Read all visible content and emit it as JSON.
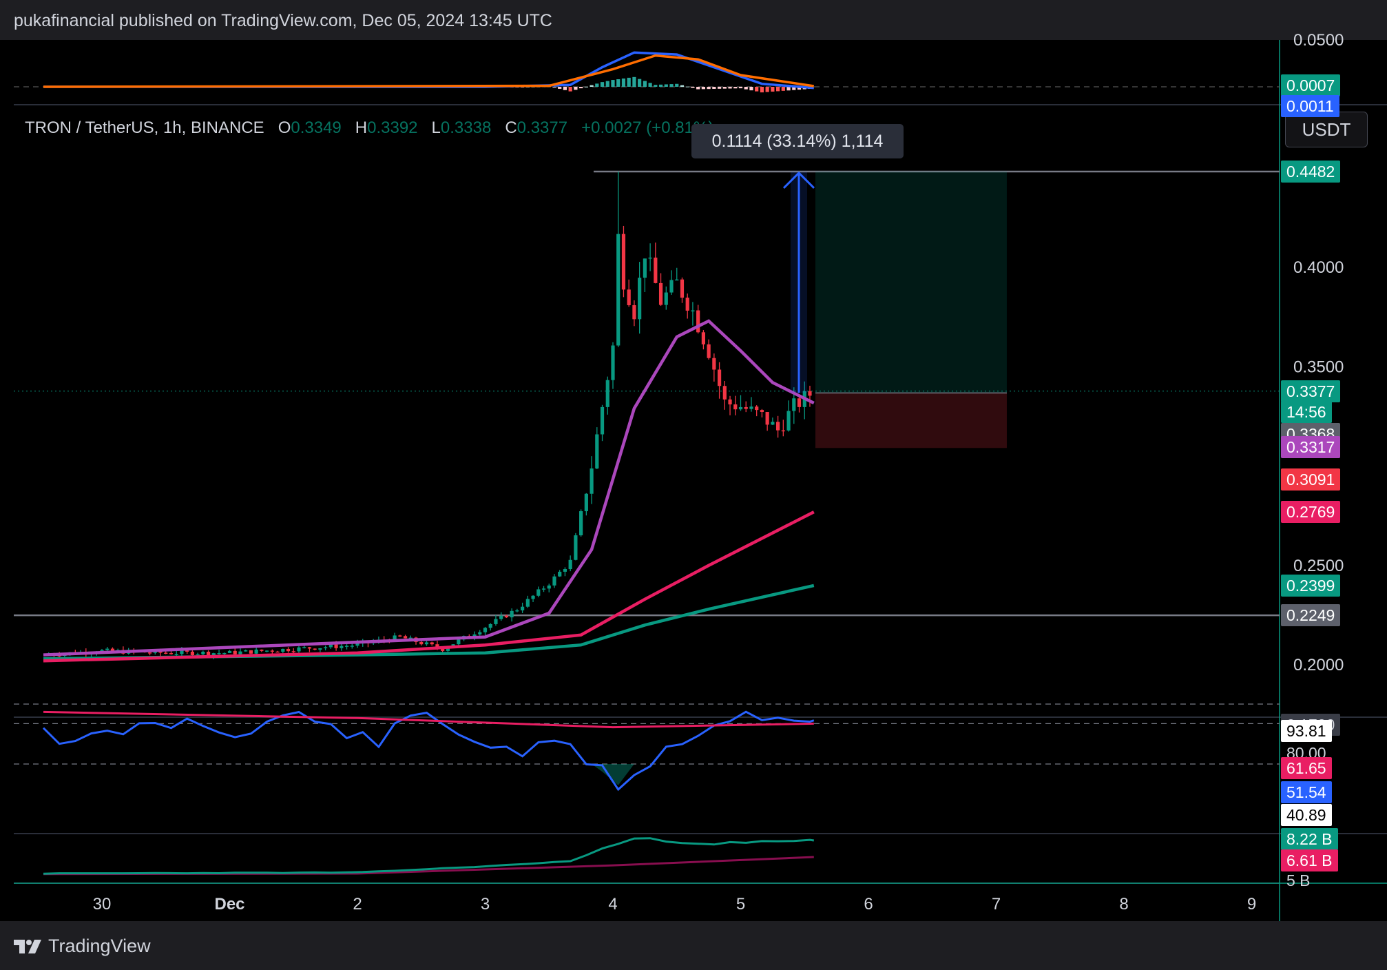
{
  "header": {
    "attribution": "pukafinancial published on TradingView.com, Dec 05, 2024 13:45 UTC"
  },
  "footer": {
    "brand": "TradingView"
  },
  "symbol": {
    "name": "TRON / TetherUS, 1h, BINANCE",
    "o_label": "O",
    "o": "0.3349",
    "h_label": "H",
    "h": "0.3392",
    "l_label": "L",
    "l": "0.3338",
    "c_label": "C",
    "c": "0.3377",
    "change": "+0.0027 (+0.81%)"
  },
  "currency_button": "USDT",
  "measure_label": "0.1114 (33.14%) 1,114",
  "colors": {
    "up": "#089981",
    "down": "#f23645",
    "ema_fast": "#ab47bc",
    "ema_mid": "#e91e63",
    "ema_slow": "#089981",
    "macd": "#2962ff",
    "signal": "#ff6d00",
    "rsi": "#2962ff",
    "rsi_ma": "#e91e63",
    "obv": "#089981",
    "obv_ma": "#880e4f",
    "grid_line": "#787b86"
  },
  "price_axis": {
    "ticks": [
      "0.4000",
      "0.3500",
      "0.2500",
      "0.2000"
    ],
    "labels": [
      {
        "text": "0.4482",
        "bg": "#089981",
        "fg": "#ffffff"
      },
      {
        "text": "0.3377",
        "bg": "#089981",
        "fg": "#ffffff"
      },
      {
        "text": "14:56",
        "bg": "#089981",
        "fg": "#ffffff"
      },
      {
        "text": "0.3368",
        "bg": "#5d606b",
        "fg": "#ffffff"
      },
      {
        "text": "0.3317",
        "bg": "#ab47bc",
        "fg": "#ffffff"
      },
      {
        "text": "0.3091",
        "bg": "#f23645",
        "fg": "#ffffff"
      },
      {
        "text": "0.2769",
        "bg": "#e91e63",
        "fg": "#ffffff"
      },
      {
        "text": "0.2399",
        "bg": "#089981",
        "fg": "#ffffff"
      },
      {
        "text": "0.2249",
        "bg": "#5d606b",
        "fg": "#ffffff"
      },
      {
        "text": "0.1700",
        "bg": "#3a3d47",
        "fg": "#d1d4dc"
      }
    ]
  },
  "macd_axis": {
    "top": "0.0500",
    "labels": [
      {
        "text": "0.0007",
        "bg": "#089981",
        "fg": "#ffffff"
      },
      {
        "text": "0.0011",
        "bg": "#2962ff",
        "fg": "#ffffff"
      }
    ]
  },
  "rsi_axis": {
    "labels": [
      {
        "text": "93.81",
        "bg": "#ffffff",
        "fg": "#000000"
      },
      {
        "text": "80.00",
        "bg": "",
        "fg": "#d1d4dc"
      },
      {
        "text": "61.65",
        "bg": "#e91e63",
        "fg": "#ffffff"
      },
      {
        "text": "51.54",
        "bg": "#2962ff",
        "fg": "#ffffff"
      },
      {
        "text": "40.89",
        "bg": "#ffffff",
        "fg": "#000000"
      }
    ]
  },
  "obv_axis": {
    "labels": [
      {
        "text": "8.22 B",
        "bg": "#089981",
        "fg": "#ffffff"
      },
      {
        "text": "6.61 B",
        "bg": "#e91e63",
        "fg": "#ffffff"
      },
      {
        "text": "5 B",
        "bg": "",
        "fg": "#d1d4dc"
      }
    ]
  },
  "time_axis": [
    "30",
    "Dec",
    "2",
    "3",
    "4",
    "5",
    "6",
    "7",
    "8",
    "9"
  ],
  "chart_data": {
    "type": "candlestick",
    "title": "TRON / TetherUS, 1h, BINANCE",
    "ylim": [
      0.17,
      0.47
    ],
    "x_range_days": [
      "2024-11-29T14:00",
      "2024-12-09T22:00"
    ],
    "ohlc_last": {
      "open": 0.3349,
      "high": 0.3392,
      "low": 0.3338,
      "close": 0.3377
    },
    "close_path": [
      [
        "2024-11-29T13:00",
        0.205
      ],
      [
        "2024-11-30T00:00",
        0.207
      ],
      [
        "2024-11-30T12:00",
        0.206
      ],
      [
        "2024-12-01T00:00",
        0.206
      ],
      [
        "2024-12-01T12:00",
        0.208
      ],
      [
        "2024-12-02T00:00",
        0.21
      ],
      [
        "2024-12-02T08:00",
        0.214
      ],
      [
        "2024-12-02T16:00",
        0.208
      ],
      [
        "2024-12-03T00:00",
        0.219
      ],
      [
        "2024-12-03T06:00",
        0.228
      ],
      [
        "2024-12-03T12:00",
        0.241
      ],
      [
        "2024-12-03T16:00",
        0.252
      ],
      [
        "2024-12-03T20:00",
        0.3
      ],
      [
        "2024-12-03T22:00",
        0.33
      ],
      [
        "2024-12-04T00:00",
        0.36
      ],
      [
        "2024-12-04T01:00",
        0.415
      ],
      [
        "2024-12-04T02:00",
        0.394
      ],
      [
        "2024-12-04T04:00",
        0.378
      ],
      [
        "2024-12-04T06:00",
        0.408
      ],
      [
        "2024-12-04T09:00",
        0.383
      ],
      [
        "2024-12-04T12:00",
        0.392
      ],
      [
        "2024-12-04T15:00",
        0.378
      ],
      [
        "2024-12-04T18:00",
        0.358
      ],
      [
        "2024-12-04T21:00",
        0.332
      ],
      [
        "2024-12-05T00:00",
        0.33
      ],
      [
        "2024-12-05T04:00",
        0.325
      ],
      [
        "2024-12-05T07:00",
        0.318
      ],
      [
        "2024-12-05T10:00",
        0.33
      ],
      [
        "2024-12-05T13:45",
        0.3377
      ]
    ],
    "high_max": 0.4482,
    "ema_fast": [
      [
        "2024-11-29T13:00",
        0.205
      ],
      [
        "2024-12-03T00:00",
        0.214
      ],
      [
        "2024-12-03T12:00",
        0.226
      ],
      [
        "2024-12-03T20:00",
        0.258
      ],
      [
        "2024-12-04T04:00",
        0.329
      ],
      [
        "2024-12-04T12:00",
        0.365
      ],
      [
        "2024-12-04T18:00",
        0.373
      ],
      [
        "2024-12-05T00:00",
        0.358
      ],
      [
        "2024-12-05T06:00",
        0.342
      ],
      [
        "2024-12-05T13:45",
        0.3317
      ]
    ],
    "ema_mid": [
      [
        "2024-11-29T13:00",
        0.202
      ],
      [
        "2024-12-02T00:00",
        0.206
      ],
      [
        "2024-12-03T00:00",
        0.21
      ],
      [
        "2024-12-03T18:00",
        0.215
      ],
      [
        "2024-12-04T06:00",
        0.233
      ],
      [
        "2024-12-04T18:00",
        0.25
      ],
      [
        "2024-12-05T13:45",
        0.2769
      ]
    ],
    "ema_slow": [
      [
        "2024-11-29T13:00",
        0.203
      ],
      [
        "2024-12-02T00:00",
        0.205
      ],
      [
        "2024-12-03T00:00",
        0.206
      ],
      [
        "2024-12-03T18:00",
        0.21
      ],
      [
        "2024-12-04T06:00",
        0.22
      ],
      [
        "2024-12-04T18:00",
        0.228
      ],
      [
        "2024-12-05T13:45",
        0.2399
      ]
    ],
    "horizontal_levels": [
      0.4482,
      0.2249
    ],
    "last_price": 0.3377,
    "position": {
      "entry": 0.3368,
      "target": 0.4482,
      "stop": 0.3091,
      "end": "2024-12-07T02:00"
    },
    "measure": {
      "from": 0.3368,
      "to": 0.4482,
      "change": 0.1114,
      "percent": 33.14,
      "ticks": 1114
    },
    "macd": {
      "macd_line": [
        [
          "2024-11-29T13:00",
          0.0
        ],
        [
          "2024-12-03T00:00",
          0.0
        ],
        [
          "2024-12-03T16:00",
          0.002
        ],
        [
          "2024-12-03T22:00",
          0.02
        ],
        [
          "2024-12-04T04:00",
          0.035
        ],
        [
          "2024-12-04T12:00",
          0.033
        ],
        [
          "2024-12-04T20:00",
          0.018
        ],
        [
          "2024-12-05T04:00",
          0.003
        ],
        [
          "2024-12-05T13:45",
          -0.0011
        ]
      ],
      "signal_line": [
        [
          "2024-11-29T13:00",
          0.0
        ],
        [
          "2024-12-03T12:00",
          0.001
        ],
        [
          "2024-12-04T00:00",
          0.018
        ],
        [
          "2024-12-04T08:00",
          0.032
        ],
        [
          "2024-12-04T16:00",
          0.028
        ],
        [
          "2024-12-05T00:00",
          0.012
        ],
        [
          "2024-12-05T13:45",
          0.0007
        ]
      ],
      "last_macd": -0.0011,
      "last_signal": 0.0007
    },
    "rsi": {
      "upper": 80,
      "lower": 40.89,
      "mid_band": 61.65,
      "last": 51.54,
      "max": 93.81,
      "values": [
        [
          "2024-11-29T13:00",
          55
        ],
        [
          "2024-11-29T18:00",
          68
        ],
        [
          "2024-11-30T04:00",
          58
        ],
        [
          "2024-11-30T16:00",
          52
        ],
        [
          "2024-12-01T04:00",
          60
        ],
        [
          "2024-12-01T12:00",
          45
        ],
        [
          "2024-12-01T20:00",
          58
        ],
        [
          "2024-12-02T04:00",
          66
        ],
        [
          "2024-12-02T12:00",
          45
        ],
        [
          "2024-12-02T20:00",
          62
        ],
        [
          "2024-12-03T06:00",
          72
        ],
        [
          "2024-12-03T16:00",
          68
        ],
        [
          "2024-12-03T22:00",
          85
        ],
        [
          "2024-12-04T01:00",
          93.81
        ],
        [
          "2024-12-04T10:00",
          70
        ],
        [
          "2024-12-04T18:00",
          55
        ],
        [
          "2024-12-05T00:00",
          48
        ],
        [
          "2024-12-05T08:00",
          47
        ],
        [
          "2024-12-05T13:45",
          51.54
        ]
      ],
      "ma": [
        [
          "2024-11-29T13:00",
          54
        ],
        [
          "2024-12-02T00:00",
          58
        ],
        [
          "2024-12-04T00:00",
          64
        ],
        [
          "2024-12-05T13:45",
          61.65
        ]
      ]
    },
    "obv": {
      "unit": "B",
      "last": 8.22,
      "ma_last": 6.61,
      "values": [
        [
          "2024-11-29T13:00",
          5.0
        ],
        [
          "2024-12-02T00:00",
          5.1
        ],
        [
          "2024-12-03T00:00",
          5.7
        ],
        [
          "2024-12-03T16:00",
          6.2
        ],
        [
          "2024-12-03T22:00",
          7.4
        ],
        [
          "2024-12-04T04:00",
          8.4
        ],
        [
          "2024-12-04T20:00",
          7.9
        ],
        [
          "2024-12-05T13:45",
          8.22
        ]
      ],
      "ma": [
        [
          "2024-11-29T13:00",
          4.95
        ],
        [
          "2024-12-02T00:00",
          5.0
        ],
        [
          "2024-12-04T00:00",
          5.8
        ],
        [
          "2024-12-05T13:45",
          6.61
        ]
      ],
      "range": [
        4.8,
        8.8
      ]
    }
  }
}
